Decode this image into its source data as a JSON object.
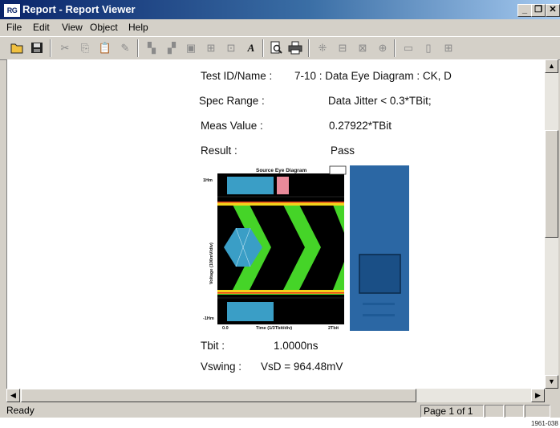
{
  "window": {
    "app_logo": "RG",
    "title": "Report - Report Viewer"
  },
  "title_buttons": {
    "minimize": "_",
    "restore": "❐",
    "close": "✕"
  },
  "menu": [
    "File",
    "Edit",
    "View",
    "Object",
    "Help"
  ],
  "toolbar_icons": [
    "open-folder-icon",
    "save-icon",
    "cut-icon",
    "copy-icon",
    "paste-icon",
    "eraser-icon",
    "send-backward-icon",
    "bring-forward-icon",
    "frame-icon",
    "align-icon",
    "group-icon",
    "text-icon",
    "print-preview-icon",
    "print-icon",
    "grid-icon",
    "align-left-icon",
    "align-center-icon",
    "distribute-icon",
    "width-icon",
    "height-icon",
    "fit-icon"
  ],
  "report": {
    "test_id_label": "Test ID/Name :",
    "test_id_value": "7-10 : Data Eye Diagram : CK, D",
    "spec_range_label": "Spec Range :",
    "spec_range_value": "Data Jitter < 0.3*TBit;",
    "meas_value_label": "Meas Value :",
    "meas_value_value": "0.27922*TBit",
    "result_label": "Result :",
    "result_value": "Pass",
    "eye_title": "Source Eye Diagram",
    "y_top": "1Hm",
    "y_bottom": "-1Hm",
    "y_axis_label": "Voltage (100mV/div)",
    "x_left": "0.0",
    "x_axis_label": "Time (1/3Tbit/div)",
    "x_right": "2Tbit",
    "tbit_label": "Tbit :",
    "tbit_value": "1.0000ns",
    "vswing_label": "Vswing :",
    "vswing_value": "VsD = 964.48mV"
  },
  "status": {
    "ready": "Ready",
    "page": "Page 1 of 1"
  },
  "figure_number": "1961-038",
  "colors": {
    "title_bar": "#0a246a",
    "chrome": "#d4d0c8",
    "eye_green": "#55ff33",
    "eye_blue": "#3a9ec6",
    "side_panel": "#2b67a4"
  }
}
